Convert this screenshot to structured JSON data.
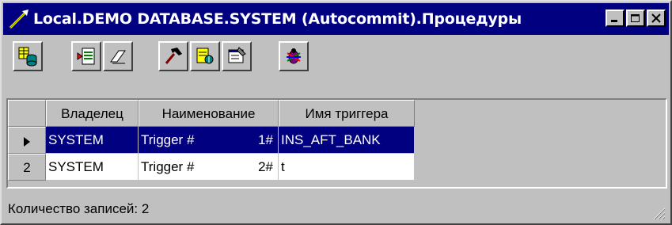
{
  "window": {
    "title": "Local.DEMO DATABASE.SYSTEM (Autocommit).Процедуры"
  },
  "toolbar": {
    "buttons": [
      {
        "icon": "database-table-icon"
      },
      {
        "icon": "insert-record-icon"
      },
      {
        "icon": "eraser-icon"
      },
      {
        "icon": "hammer-icon"
      },
      {
        "icon": "sql-query-icon"
      },
      {
        "icon": "properties-icon"
      },
      {
        "icon": "debug-bug-icon"
      }
    ]
  },
  "grid": {
    "columns": [
      "Владелец",
      "Наименование",
      "Имя триггера"
    ],
    "rows": [
      {
        "indicator": "",
        "current": true,
        "owner": "SYSTEM",
        "name": "Trigger #",
        "num": "1#",
        "trigger": "INS_AFT_BANK"
      },
      {
        "indicator": "2",
        "current": false,
        "owner": "SYSTEM",
        "name": "Trigger #",
        "num": "2#",
        "trigger": "t"
      }
    ]
  },
  "status": {
    "text": "Количество записей: 2"
  },
  "colors": {
    "titlebar": "#000080",
    "selection": "#000080",
    "face": "#c0c0c0"
  }
}
